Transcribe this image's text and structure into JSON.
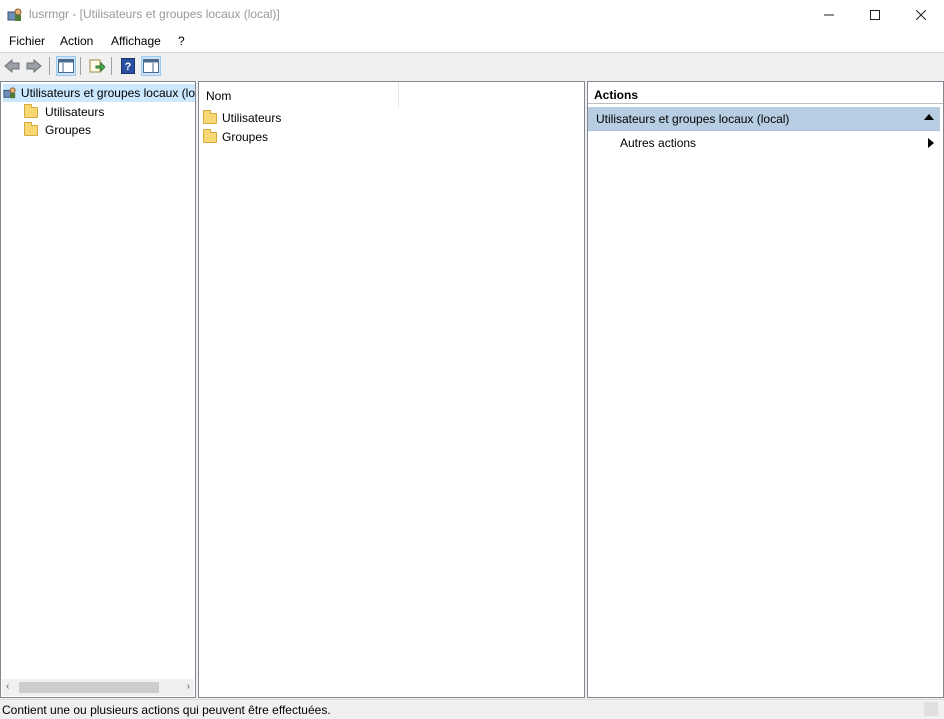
{
  "window": {
    "title": "lusrmgr - [Utilisateurs et groupes locaux (local)]"
  },
  "menu": {
    "items": [
      "Fichier",
      "Action",
      "Affichage",
      "?"
    ]
  },
  "toolbar": {
    "buttons": [
      "back-icon",
      "forward-icon",
      "show-hide-tree-icon",
      "export-list-icon",
      "help-icon",
      "show-hide-action-pane-icon"
    ]
  },
  "tree": {
    "root_label": "Utilisateurs et groupes locaux (lo",
    "children": [
      "Utilisateurs",
      "Groupes"
    ]
  },
  "list": {
    "column_header": "Nom",
    "items": [
      "Utilisateurs",
      "Groupes"
    ]
  },
  "actions": {
    "header": "Actions",
    "section_title": "Utilisateurs et groupes locaux (local)",
    "items": [
      "Autres actions"
    ]
  },
  "status": {
    "text": "Contient une ou plusieurs actions qui peuvent être effectuées."
  },
  "colors": {
    "selection": "#cce8ff",
    "action_section": "#b6cde2",
    "border": "#828790"
  }
}
